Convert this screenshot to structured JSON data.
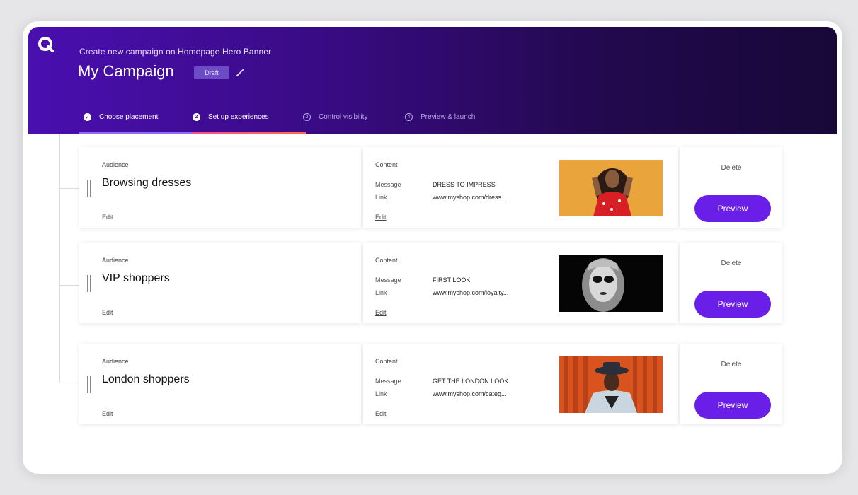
{
  "header": {
    "subtitle": "Create new campaign on Homepage Hero Banner",
    "title": "My Campaign",
    "status_badge": "Draft",
    "steps": [
      {
        "num": "✓",
        "label": "Choose placement"
      },
      {
        "num": "2",
        "label": "Set up experiences"
      },
      {
        "num": "3",
        "label": "Control visibility"
      },
      {
        "num": "4",
        "label": "Preview & launch"
      }
    ]
  },
  "experiences": [
    {
      "audience_label": "Audience",
      "audience": "Browsing dresses",
      "edit": "Edit",
      "content_label": "Content",
      "message_label": "Message",
      "message": "DRESS TO IMPRESS",
      "link_label": "Link",
      "link": "www.myshop.com/dress...",
      "content_edit": "Edit",
      "delete": "Delete",
      "preview": "Preview"
    },
    {
      "audience_label": "Audience",
      "audience": "VIP shoppers",
      "edit": "Edit",
      "content_label": "Content",
      "message_label": "Message",
      "message": "FIRST LOOK",
      "link_label": "Link",
      "link": "www.myshop.com/loyalty...",
      "content_edit": "Edit",
      "delete": "Delete",
      "preview": "Preview"
    },
    {
      "audience_label": "Audience",
      "audience": "London shoppers",
      "edit": "Edit",
      "content_label": "Content",
      "message_label": "Message",
      "message": "GET THE LONDON LOOK",
      "link_label": "Link",
      "link": "www.myshop.com/categ...",
      "content_edit": "Edit",
      "delete": "Delete",
      "preview": "Preview"
    }
  ],
  "colors": {
    "accent": "#6a1fe8",
    "header_start": "#4a0fb0",
    "header_end": "#180838",
    "step_progress": "#ff4d8d"
  }
}
